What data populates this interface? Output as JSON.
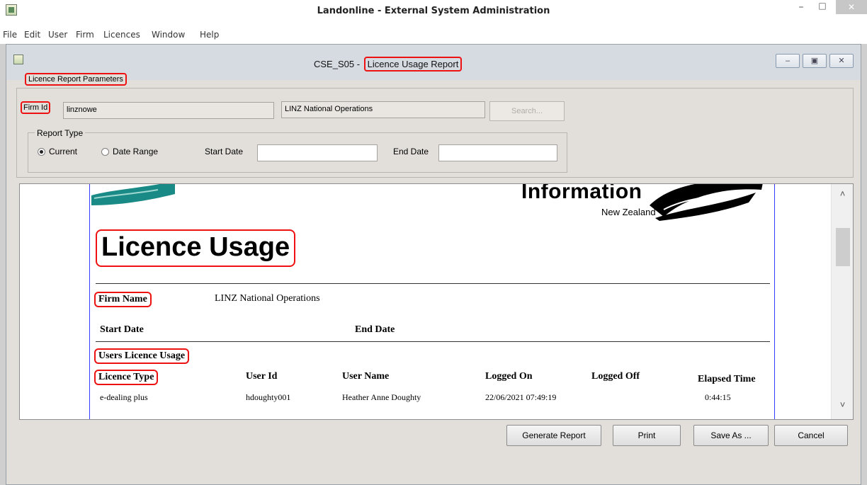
{
  "app": {
    "title": "Landonline - External System Administration",
    "controls": {
      "minimize": "–",
      "maximize": "□",
      "close": "✕"
    }
  },
  "menu": [
    {
      "label": "File"
    },
    {
      "label": "Edit"
    },
    {
      "label": "User"
    },
    {
      "label": "Firm"
    },
    {
      "label": "Licences"
    },
    {
      "label": "Window"
    },
    {
      "label": "Help"
    }
  ],
  "child_window": {
    "title_prefix": "CSE_S05 -",
    "title_main": "Licence Usage Report",
    "controls": {
      "minimize": "–",
      "restore": "▣",
      "close": "✕"
    }
  },
  "parameters": {
    "legend": "Licence Report Parameters",
    "firm_id_label": "Firm Id",
    "firm_id_value": "linznowe",
    "firm_name_value": "LINZ National Operations",
    "search_label": "Search...",
    "report_type": {
      "legend": "Report Type",
      "options": [
        {
          "label": "Current",
          "selected": true
        },
        {
          "label": "Date Range",
          "selected": false
        }
      ],
      "start_date_label": "Start Date",
      "start_date_value": "",
      "end_date_label": "End Date",
      "end_date_value": ""
    }
  },
  "report": {
    "logo_text": "Information",
    "logo_sub": "New Zealand",
    "title": "Licence Usage",
    "firm_name_label": "Firm Name",
    "firm_name_value": "LINZ National Operations",
    "start_date_label": "Start Date",
    "end_date_label": "End Date",
    "section_title": "Users Licence Usage",
    "columns": [
      "Licence Type",
      "User Id",
      "User Name",
      "Logged On",
      "Logged Off",
      "Elapsed Time"
    ],
    "rows": [
      {
        "licence_type": "e-dealing plus",
        "user_id": "hdoughty001",
        "user_name": "Heather Anne Doughty",
        "logged_on": "22/06/2021 07:49:19",
        "logged_off": "",
        "elapsed_time": "0:44:15"
      }
    ]
  },
  "scrollbar": {
    "up": "˄",
    "down": "˅"
  },
  "buttons": {
    "generate": "Generate Report",
    "print": "Print",
    "save_as": "Save As ...",
    "cancel": "Cancel"
  },
  "colors": {
    "highlight": "#ee1111",
    "page_border": "#3b3bff",
    "logo_teal": "#1a8a86"
  }
}
